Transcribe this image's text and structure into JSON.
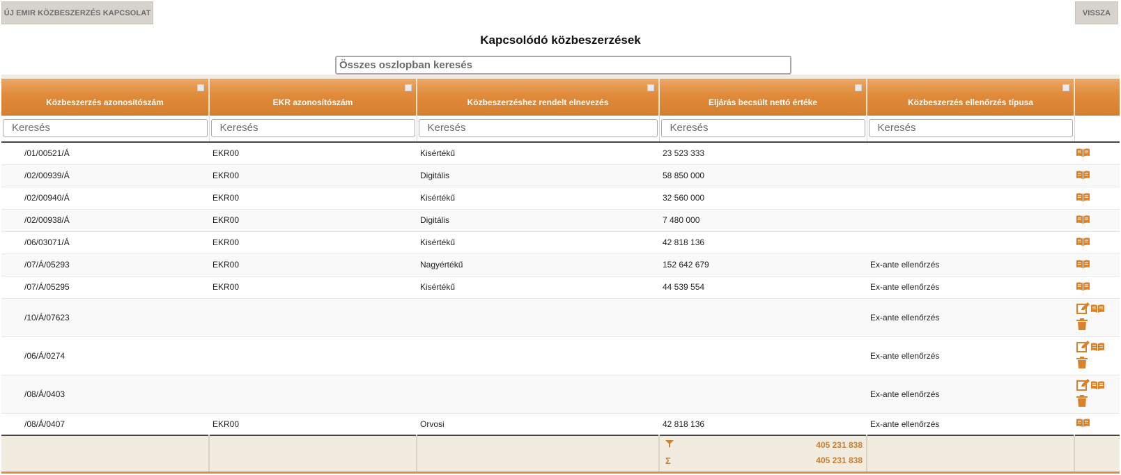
{
  "toolbar": {
    "new_label": "ÚJ EMIR KÖZBESZERZÉS KAPCSOLAT",
    "back_label": "VISSZA"
  },
  "page": {
    "title": "Kapcsolódó közbeszerzések",
    "global_search_placeholder": "Összes oszlopban keresés"
  },
  "table": {
    "columns": [
      "Közbeszerzés azonosítószám",
      "EKR azonosítószám",
      "Közbeszerzéshez rendelt elnevezés",
      "Eljárás becsült nettó értéke",
      "Közbeszerzés ellenőrzés típusa"
    ],
    "filter_placeholder": "Keresés",
    "rows": [
      {
        "id": "/01/00521/Á",
        "ekr": "EKR00",
        "name": "Kisértékű",
        "value": "23 523 333",
        "check": "",
        "editable": false
      },
      {
        "id": "/02/00939/Á",
        "ekr": "EKR00",
        "name": "Digitális",
        "value": "58 850 000",
        "check": "",
        "editable": false
      },
      {
        "id": "/02/00940/Á",
        "ekr": "EKR00",
        "name": "Kisértékű",
        "value": "32 560 000",
        "check": "",
        "editable": false
      },
      {
        "id": "/02/00938/Á",
        "ekr": "EKR00",
        "name": "Digitális",
        "value": "7 480 000",
        "check": "",
        "editable": false
      },
      {
        "id": "/06/03071/Á",
        "ekr": "EKR00",
        "name": "Kisértékű",
        "value": "42 818 136",
        "check": "",
        "editable": false
      },
      {
        "id": "/07/Á/05293",
        "ekr": "EKR00",
        "name": "Nagyértékű",
        "value": "152 642 679",
        "check": "Ex-ante ellenőrzés",
        "editable": false
      },
      {
        "id": "/07/Á/05295",
        "ekr": "EKR00",
        "name": "Kisértékű",
        "value": "44 539 554",
        "check": "Ex-ante ellenőrzés",
        "editable": false
      },
      {
        "id": "/10/Á/07623",
        "ekr": "",
        "name": "",
        "value": "",
        "check": "Ex-ante ellenőrzés",
        "editable": true
      },
      {
        "id": "/06/Á/0274",
        "ekr": "",
        "name": "",
        "value": "",
        "check": "Ex-ante ellenőrzés",
        "editable": true
      },
      {
        "id": "/08/Á/0403",
        "ekr": "",
        "name": "",
        "value": "",
        "check": "Ex-ante ellenőrzés",
        "editable": true
      },
      {
        "id": "/08/Á/0407",
        "ekr": "EKR00",
        "name": "Orvosi",
        "value": "42 818 136",
        "check": "Ex-ante ellenőrzés",
        "editable": false
      }
    ],
    "footer": {
      "filtered_total": "405 231 838",
      "grand_total": "405 231 838"
    }
  },
  "icons": {
    "view": "open-book-icon",
    "edit": "edit-icon",
    "delete": "trash-icon",
    "filter": "filter-funnel-icon",
    "sum": "sigma-sum-icon"
  },
  "colors": {
    "header_orange": "#e08a3a",
    "icon_orange": "#d9822b",
    "button_gray": "#d6d3cd"
  }
}
